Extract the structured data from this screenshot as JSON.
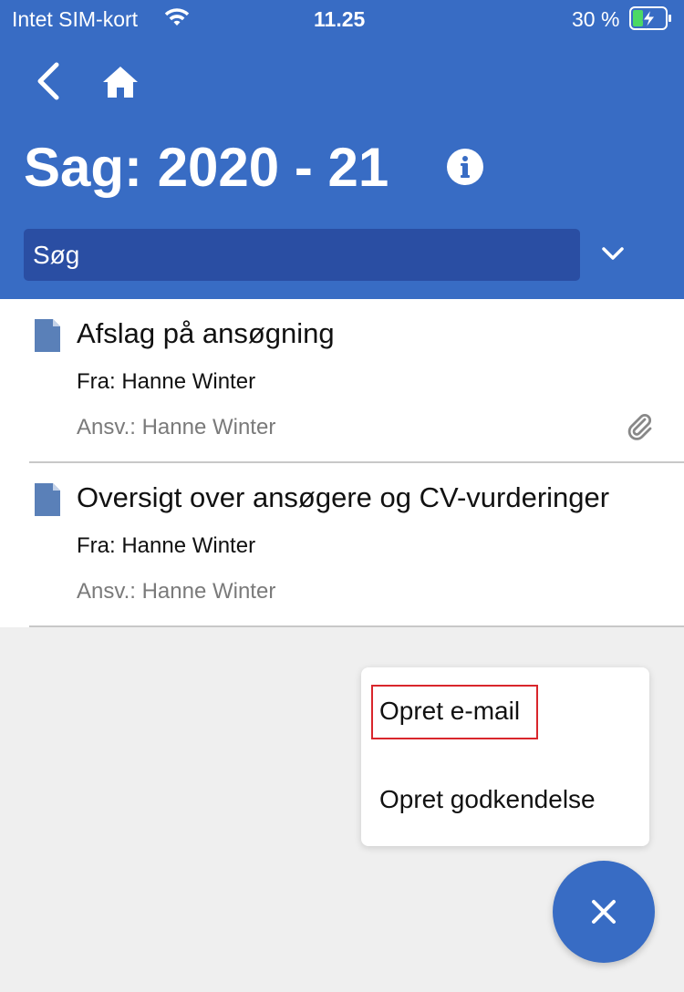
{
  "status_bar": {
    "carrier": "Intet SIM-kort",
    "time": "11.25",
    "battery_percent": "30 %",
    "battery_level": 0.3
  },
  "header": {
    "title": "Sag: 2020 - 21",
    "search_placeholder": "Søg",
    "background_color": "#386cc4"
  },
  "documents": [
    {
      "title": "Afslag på ansøgning",
      "from": "Fra: Hanne Winter",
      "responsible": "Ansv.: Hanne Winter",
      "has_attachment": true
    },
    {
      "title": "Oversigt over ansøgere og CV-vurderinger",
      "from": "Fra: Hanne Winter",
      "responsible": "Ansv.: Hanne Winter",
      "has_attachment": false
    }
  ],
  "fab_menu": {
    "items": [
      {
        "label": "Opret e-mail",
        "highlighted": true
      },
      {
        "label": "Opret godkendelse",
        "highlighted": false
      }
    ]
  },
  "icons": {
    "back": "chevron-left-icon",
    "home": "home-icon",
    "info": "info-icon",
    "dropdown": "chevron-down-icon",
    "document": "document-icon",
    "attachment": "paperclip-icon",
    "close": "close-icon"
  }
}
